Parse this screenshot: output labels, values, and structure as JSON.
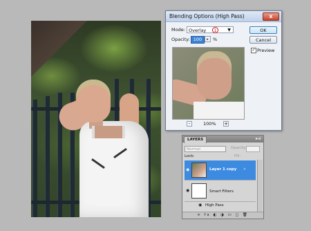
{
  "dialog": {
    "title": "Blending Options (High Pass)",
    "close_glyph": "x",
    "mode_label": "Mode:",
    "mode_value": "Overlay",
    "marker": "1",
    "opacity_label": "Opacity:",
    "opacity_value": "100",
    "opacity_unit": "%",
    "ok_label": "OK",
    "cancel_label": "Cancel",
    "preview_label": "Preview",
    "preview_checked": "✓",
    "zoom_minus": "-",
    "zoom_plus": "+",
    "zoom_value": "100%"
  },
  "layers_panel": {
    "tab_label": "LAYERS",
    "menu_glyph": "▸≡",
    "blend_mode": "Normal",
    "opacity_label": "Opacity:",
    "lock_label": "Lock:",
    "fill_label": "Fill:",
    "layers": [
      {
        "name": "Layer 1 copy",
        "selected": true
      },
      {
        "name": "Smart Filters",
        "selected": false
      },
      {
        "name": "High Pass",
        "selected": false
      }
    ],
    "bottom_icons": "∞ fx ◐ ◑ ▭ ◻ 🗑",
    "fx_glyph": "✧"
  }
}
